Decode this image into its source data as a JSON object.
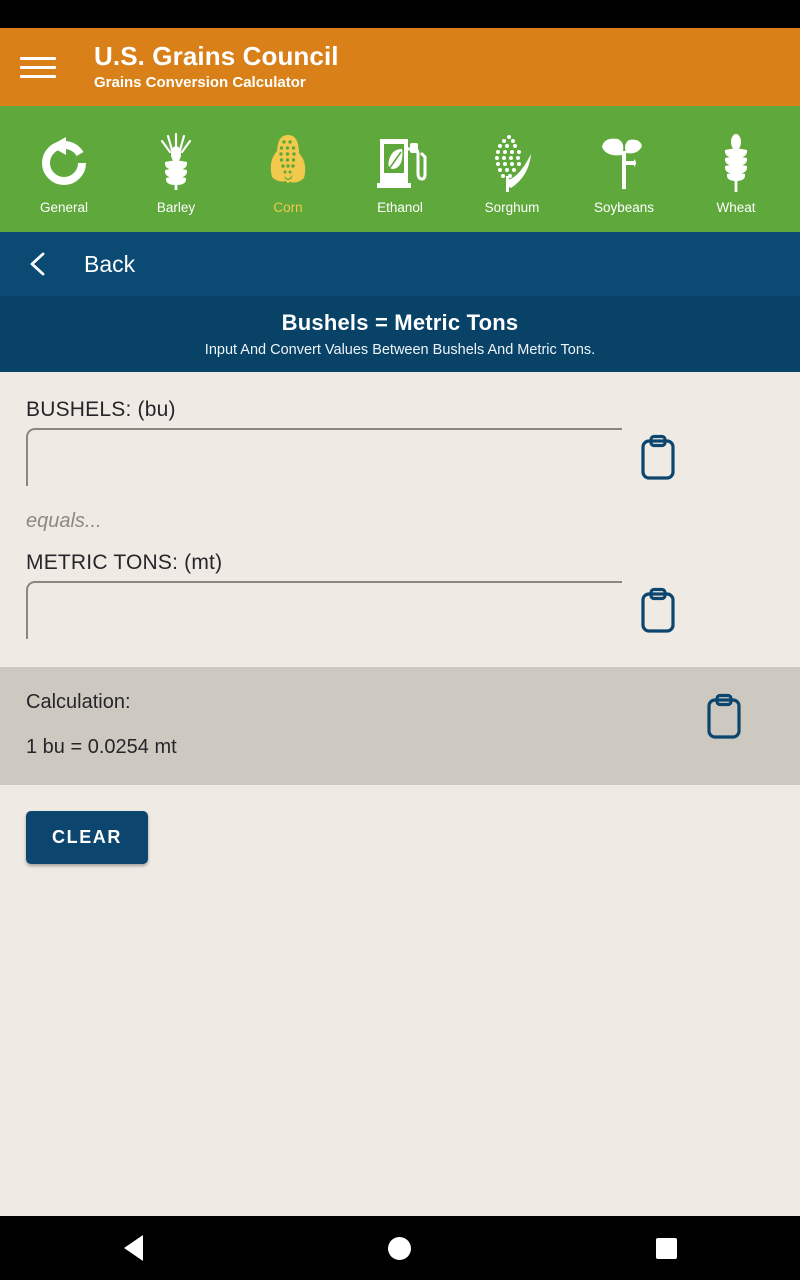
{
  "header": {
    "menu_icon": "hamburger-menu-icon",
    "title": "U.S. Grains Council",
    "subtitle": "Grains Conversion Calculator",
    "bg_color": "#d98019"
  },
  "nav": {
    "bg_color": "#5fa83c",
    "active_color": "#f2c94c",
    "items": [
      {
        "label": "General",
        "icon": "refresh-arrow-icon",
        "active": false
      },
      {
        "label": "Barley",
        "icon": "barley-stalk-icon",
        "active": false
      },
      {
        "label": "Corn",
        "icon": "corn-cob-icon",
        "active": true
      },
      {
        "label": "Ethanol",
        "icon": "fuel-pump-leaf-icon",
        "active": false
      },
      {
        "label": "Sorghum",
        "icon": "sorghum-head-icon",
        "active": false
      },
      {
        "label": "Soybeans",
        "icon": "soybean-sprout-icon",
        "active": false
      },
      {
        "label": "Wheat",
        "icon": "wheat-stalk-icon",
        "active": false
      }
    ]
  },
  "back_bar": {
    "icon": "chevron-left-icon",
    "label": "Back",
    "bg_color": "#0a4a73"
  },
  "page": {
    "title": "Bushels = Metric Tons",
    "description": "Input And Convert Values Between Bushels And Metric Tons.",
    "bg_color": "#084267"
  },
  "form": {
    "bushels": {
      "label": "BUSHELS: (bu)",
      "value": "",
      "placeholder": "",
      "copy_icon": "clipboard-icon"
    },
    "equals_text": "equals...",
    "metric_tons": {
      "label": "METRIC TONS: (mt)",
      "value": "",
      "placeholder": "",
      "copy_icon": "clipboard-icon"
    }
  },
  "calculation": {
    "label": "Calculation:",
    "value": "1 bu = 0.0254 mt",
    "copy_icon": "clipboard-icon",
    "bg_color": "#cdc9c0"
  },
  "actions": {
    "clear_label": "CLEAR",
    "clear_color": "#0c466e"
  },
  "system_nav": {
    "back_icon": "triangle-back-icon",
    "home_icon": "circle-home-icon",
    "recents_icon": "square-recents-icon"
  }
}
